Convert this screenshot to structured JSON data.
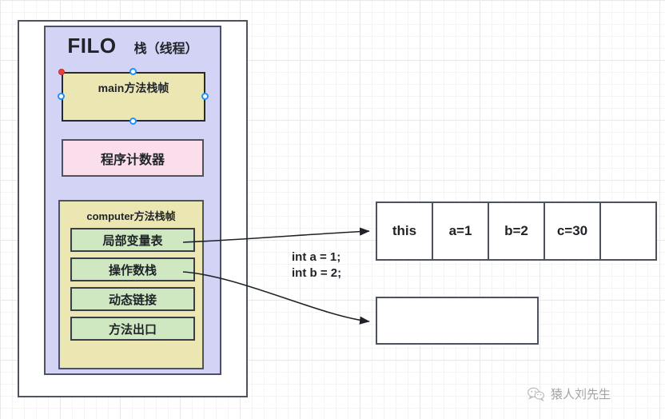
{
  "diagram": {
    "outer_container": {
      "name": "jvm-runtime-outer"
    },
    "stack_panel": {
      "title_left": "FILO",
      "title_right": "栈（线程）",
      "main_frame": {
        "label": "main方法栈帧"
      },
      "pc_register": {
        "label": "程序计数器"
      },
      "computer_frame": {
        "title": "computer方法栈帧",
        "items": [
          {
            "label": "局部变量表"
          },
          {
            "label": "操作数栈"
          },
          {
            "label": "动态链接"
          },
          {
            "label": "方法出口"
          }
        ]
      }
    },
    "local_var_table": {
      "cells": [
        {
          "value": "this"
        },
        {
          "value": "a=1"
        },
        {
          "value": "b=2"
        },
        {
          "value": "c=30"
        },
        {
          "value": ""
        }
      ]
    },
    "operand_stack_box": {
      "value": ""
    },
    "code_note": {
      "line1": "int a = 1;",
      "line2": "int b = 2;"
    },
    "watermark": {
      "text": "猿人刘先生",
      "icon": "wechat-icon"
    },
    "colors": {
      "lavender": "#d3d3f5",
      "yellow": "#ece6b3",
      "pink": "#fbdeec",
      "green": "#cfe8c2",
      "border": "#4c525e",
      "handle_blue": "#1e90ff",
      "handle_red": "#e8413a"
    }
  }
}
